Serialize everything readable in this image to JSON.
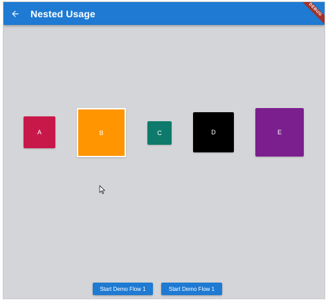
{
  "appbar": {
    "title": "Nested Usage",
    "back_icon": "arrow-back-icon",
    "debug_banner": "DEBUG",
    "color": "#1e7ad2"
  },
  "boxes": [
    {
      "label": "A",
      "color": "#c8184a"
    },
    {
      "label": "B",
      "color": "#ff9500"
    },
    {
      "label": "C",
      "color": "#0d7a6c"
    },
    {
      "label": "D",
      "color": "#000000"
    },
    {
      "label": "E",
      "color": "#7b1f8e"
    }
  ],
  "buttons": {
    "flow1_label": "Start Demo Flow 1",
    "flow2_label": "Start Demo Flow 1"
  },
  "background": "#d4d5d8"
}
